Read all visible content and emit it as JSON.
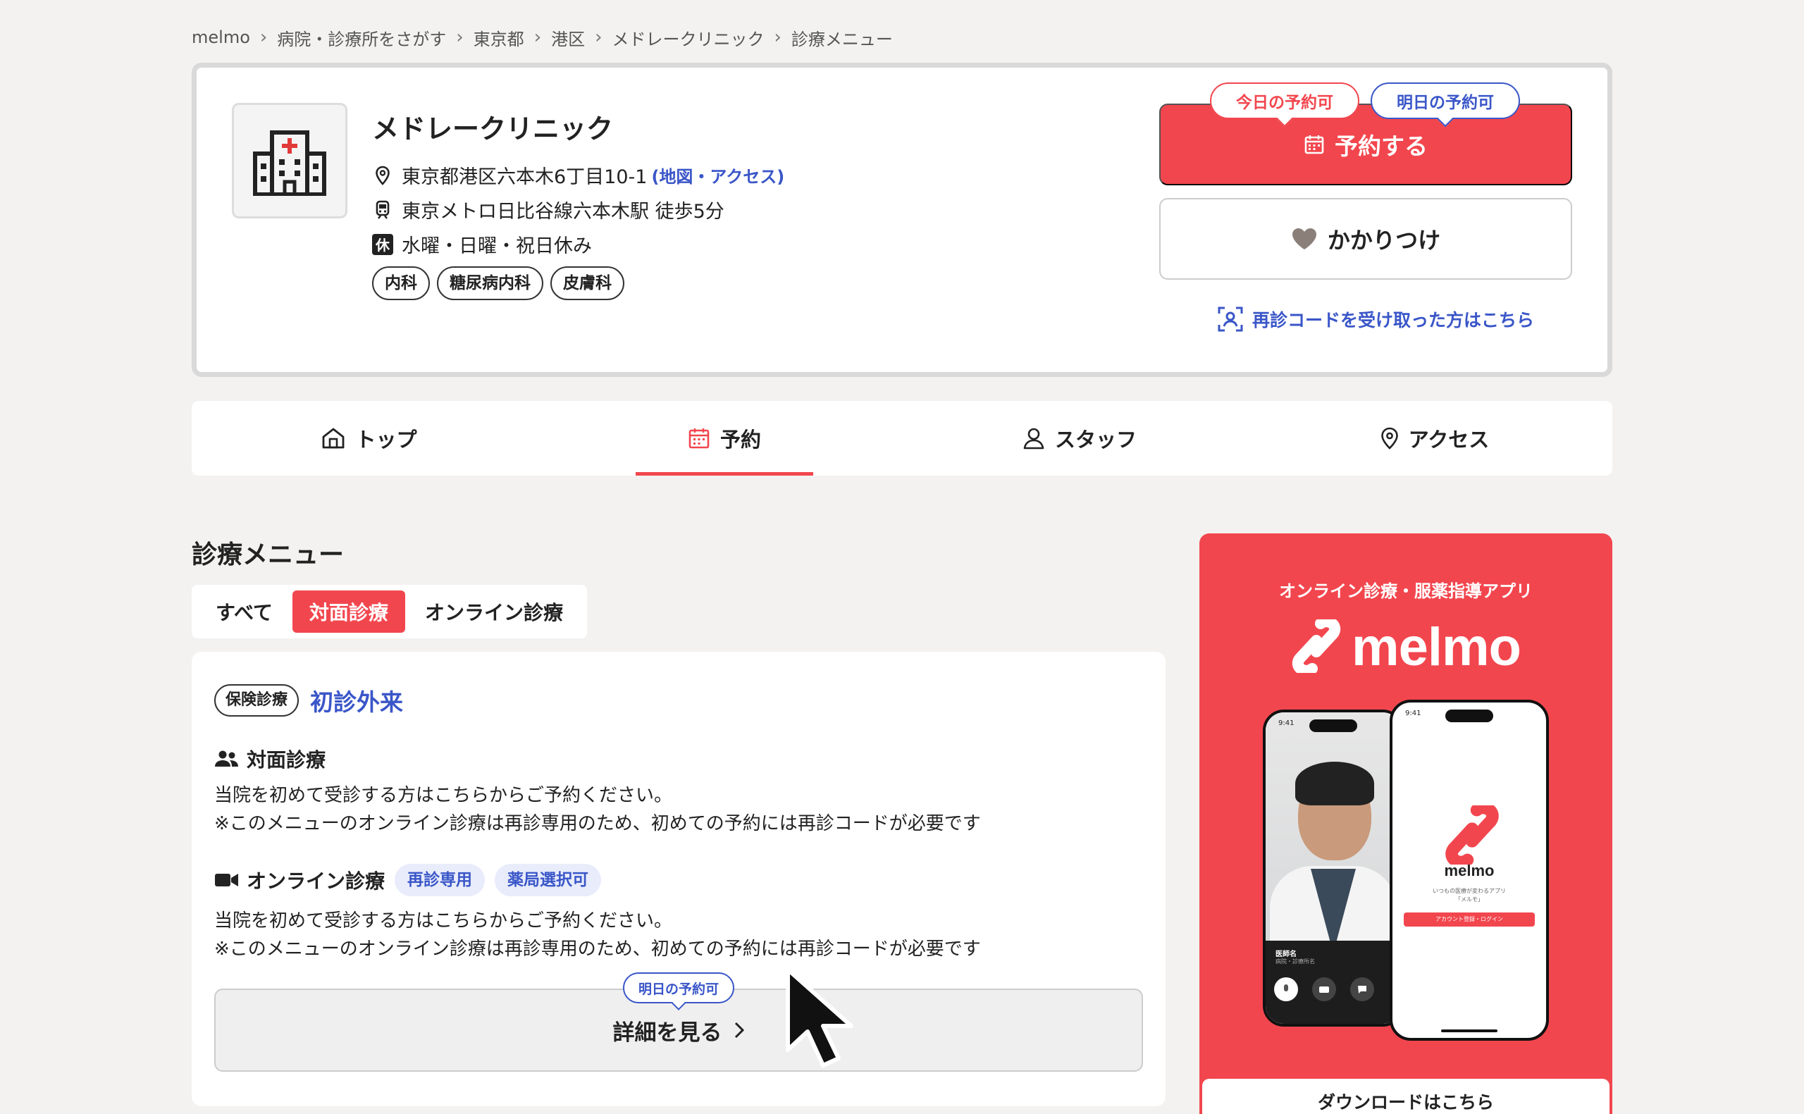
{
  "breadcrumb": [
    "melmo",
    "病院・診療所をさがす",
    "東京都",
    "港区",
    "メドレークリニック",
    "診療メニュー"
  ],
  "clinic": {
    "name": "メドレークリニック",
    "address": "東京都港区六本木6丁目10-1",
    "map_link": "(地図・アクセス)",
    "station": "東京メトロ日比谷線六本木駅 徒歩5分",
    "closed_badge": "休",
    "closed_days": "水曜・日曜・祝日休み",
    "departments": [
      "内科",
      "糖尿病内科",
      "皮膚科"
    ]
  },
  "actions": {
    "today_badge": "今日の予約可",
    "tomorrow_badge": "明日の予約可",
    "reserve_label": "予約する",
    "favorite_label": "かかりつけ",
    "revisit_code_link": "再診コードを受け取った方はこちら"
  },
  "tabs": [
    {
      "label": "トップ",
      "icon": "home-icon",
      "active": false
    },
    {
      "label": "予約",
      "icon": "calendar-icon",
      "active": true
    },
    {
      "label": "スタッフ",
      "icon": "person-icon",
      "active": false
    },
    {
      "label": "アクセス",
      "icon": "location-pin-icon",
      "active": false
    }
  ],
  "menu": {
    "title": "診療メニュー",
    "filters": [
      {
        "label": "すべて",
        "active": false
      },
      {
        "label": "対面診療",
        "active": true
      },
      {
        "label": "オンライン診療",
        "active": false
      }
    ],
    "card": {
      "insurance_tag": "保険診療",
      "title": "初診外来",
      "in_person": {
        "label": "対面診療",
        "line1": "当院を初めて受診する方はこちらからご予約ください。",
        "line2": "※このメニューのオンライン診療は再診専用のため、初めての予約には再診コードが必要です"
      },
      "online": {
        "label": "オンライン診療",
        "chips": [
          "再診専用",
          "薬局選択可"
        ],
        "line1": "当院を初めて受診する方はこちらからご予約ください。",
        "line2": "※このメニューのオンライン診療は再診専用のため、初めての予約には再診コードが必要です"
      },
      "detail_badge": "明日の予約可",
      "detail_label": "詳細を見る"
    }
  },
  "promo": {
    "tagline": "オンライン診療・服薬指導アプリ",
    "brand": "melmo",
    "phone_time": "9:41",
    "doctor_label": "医師名",
    "doctor_sub": "病院・診療所名",
    "app_brand": "melmo",
    "app_tagline_1": "いつもの医療が変わるアプリ",
    "app_tagline_2": "「メルモ」",
    "app_button": "アカウント登録・ログイン",
    "download_label": "ダウンロードはこちら"
  },
  "colors": {
    "accent": "#f2464e",
    "link": "#3a56c8",
    "background": "#f3f2f0"
  }
}
